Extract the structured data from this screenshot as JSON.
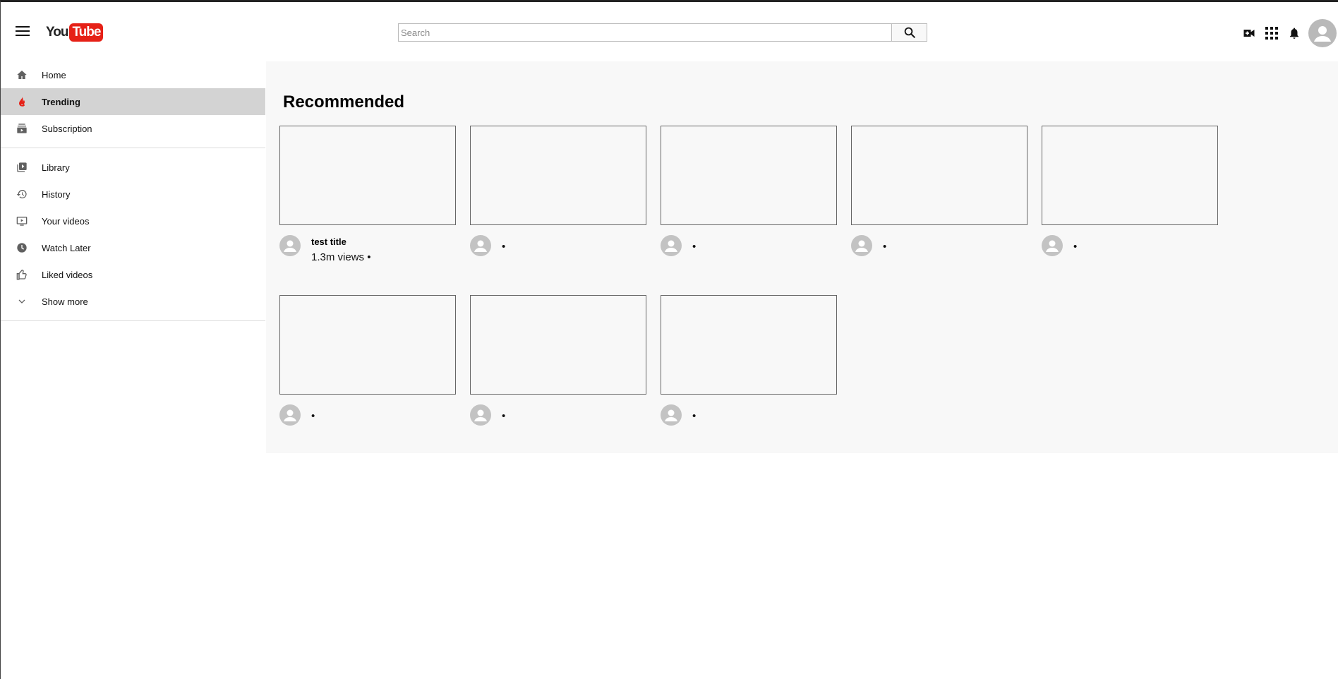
{
  "header": {
    "logo_you": "You",
    "logo_tube": "Tube",
    "search_placeholder": "Search"
  },
  "sidebar": {
    "items": [
      {
        "label": "Home",
        "icon": "home-icon",
        "active": false
      },
      {
        "label": "Trending",
        "icon": "trending-flame-icon",
        "active": true
      },
      {
        "label": "Subscription",
        "icon": "subscriptions-icon",
        "active": false
      }
    ],
    "items2": [
      {
        "label": "Library",
        "icon": "library-icon"
      },
      {
        "label": "History",
        "icon": "history-icon"
      },
      {
        "label": "Your videos",
        "icon": "your-videos-icon"
      },
      {
        "label": "Watch Later",
        "icon": "watch-later-icon"
      },
      {
        "label": "Liked videos",
        "icon": "liked-videos-icon"
      },
      {
        "label": "Show more",
        "icon": "chevron-down-icon"
      }
    ]
  },
  "main": {
    "heading": "Recommended",
    "videos": [
      {
        "title": "test title",
        "views": "1.3m views •"
      },
      {
        "title": "",
        "views": "•"
      },
      {
        "title": "",
        "views": "•"
      },
      {
        "title": "",
        "views": "•"
      },
      {
        "title": "",
        "views": "•"
      },
      {
        "title": "",
        "views": "•"
      },
      {
        "title": "",
        "views": "•"
      },
      {
        "title": "",
        "views": "•"
      }
    ]
  },
  "colors": {
    "brand_red": "#e62117",
    "active_bg": "#d3d3d3",
    "content_bg": "#f8f8f8"
  }
}
